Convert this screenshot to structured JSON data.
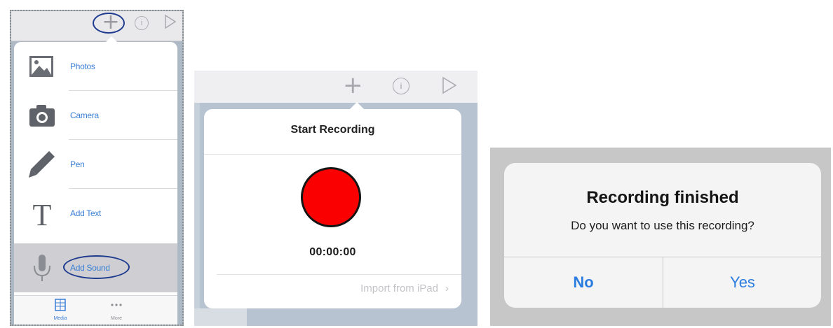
{
  "panel_add_menu": {
    "toolbar": {
      "plus_icon": "+",
      "info_icon": "i",
      "play_icon": "play-icon"
    },
    "items": [
      {
        "label": "Photos",
        "icon": "photos-icon"
      },
      {
        "label": "Camera",
        "icon": "camera-icon"
      },
      {
        "label": "Pen",
        "icon": "pen-icon"
      },
      {
        "label": "Add Text",
        "icon": "text-icon"
      },
      {
        "label": "Add Sound",
        "icon": "microphone-icon",
        "selected": true
      }
    ],
    "tabs": [
      {
        "label": "Media",
        "icon": "media-grid-icon",
        "selected": true
      },
      {
        "label": "More",
        "icon": "more-dots-icon",
        "selected": false
      }
    ],
    "colors": {
      "accent": "#3a7fd6",
      "highlight_oval": "#1f3b8f"
    }
  },
  "panel_start_recording": {
    "toolbar": {
      "plus_icon": "+",
      "info_icon": "i",
      "play_icon": "play-icon"
    },
    "title": "Start Recording",
    "timer": "00:00:00",
    "import_label": "Import from iPad",
    "import_chevron": "›",
    "colors": {
      "record_button": "#fa0000"
    }
  },
  "panel_recording_finished": {
    "title": "Recording finished",
    "message": "Do you want to use this recording?",
    "buttons": {
      "no": "No",
      "yes": "Yes"
    },
    "colors": {
      "button_text": "#2c7de0"
    }
  }
}
